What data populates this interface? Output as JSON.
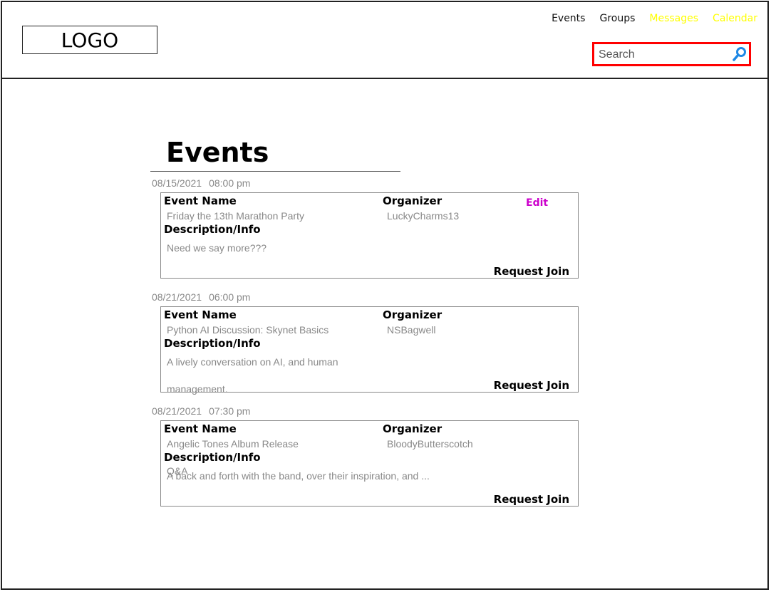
{
  "header": {
    "logo": "LOGO",
    "nav": [
      {
        "label": "Events",
        "color": "#111111"
      },
      {
        "label": "Groups",
        "color": "#111111"
      },
      {
        "label": "Messages",
        "color": "#ffff00"
      },
      {
        "label": "Calendar",
        "color": "#ffff00"
      }
    ],
    "search": {
      "placeholder": "Search",
      "value": "",
      "icon": "search-icon"
    }
  },
  "main": {
    "title": "Events",
    "labels": {
      "event_name": "Event Name",
      "organizer": "Organizer",
      "description": "Description/Info",
      "request_join": "Request Join",
      "edit": "Edit"
    },
    "events": [
      {
        "date": "08/15/2021",
        "time": "08:00 pm",
        "name": "Friday the 13th Marathon Party",
        "organizer": "LuckyCharms13",
        "description_lines": [
          "Need we say more???"
        ],
        "editable": true
      },
      {
        "date": "08/21/2021",
        "time": "06:00 pm",
        "name": "Python AI Discussion: Skynet Basics",
        "organizer": "NSBagwell",
        "description_lines": [
          "A lively conversation on AI, and human",
          "management."
        ],
        "editable": false
      },
      {
        "date": "08/21/2021",
        "time": "07:30 pm",
        "name": "Angelic Tones Album Release",
        "organizer": "BloodyButterscotch",
        "description_lines": [
          "Q&A",
          "A back and forth with the band, over their inspiration, and ..."
        ],
        "editable": false
      }
    ]
  },
  "colors": {
    "accent_edit": "#cc00cc",
    "search_border": "#ff0000",
    "search_icon": "#1e88e5"
  }
}
